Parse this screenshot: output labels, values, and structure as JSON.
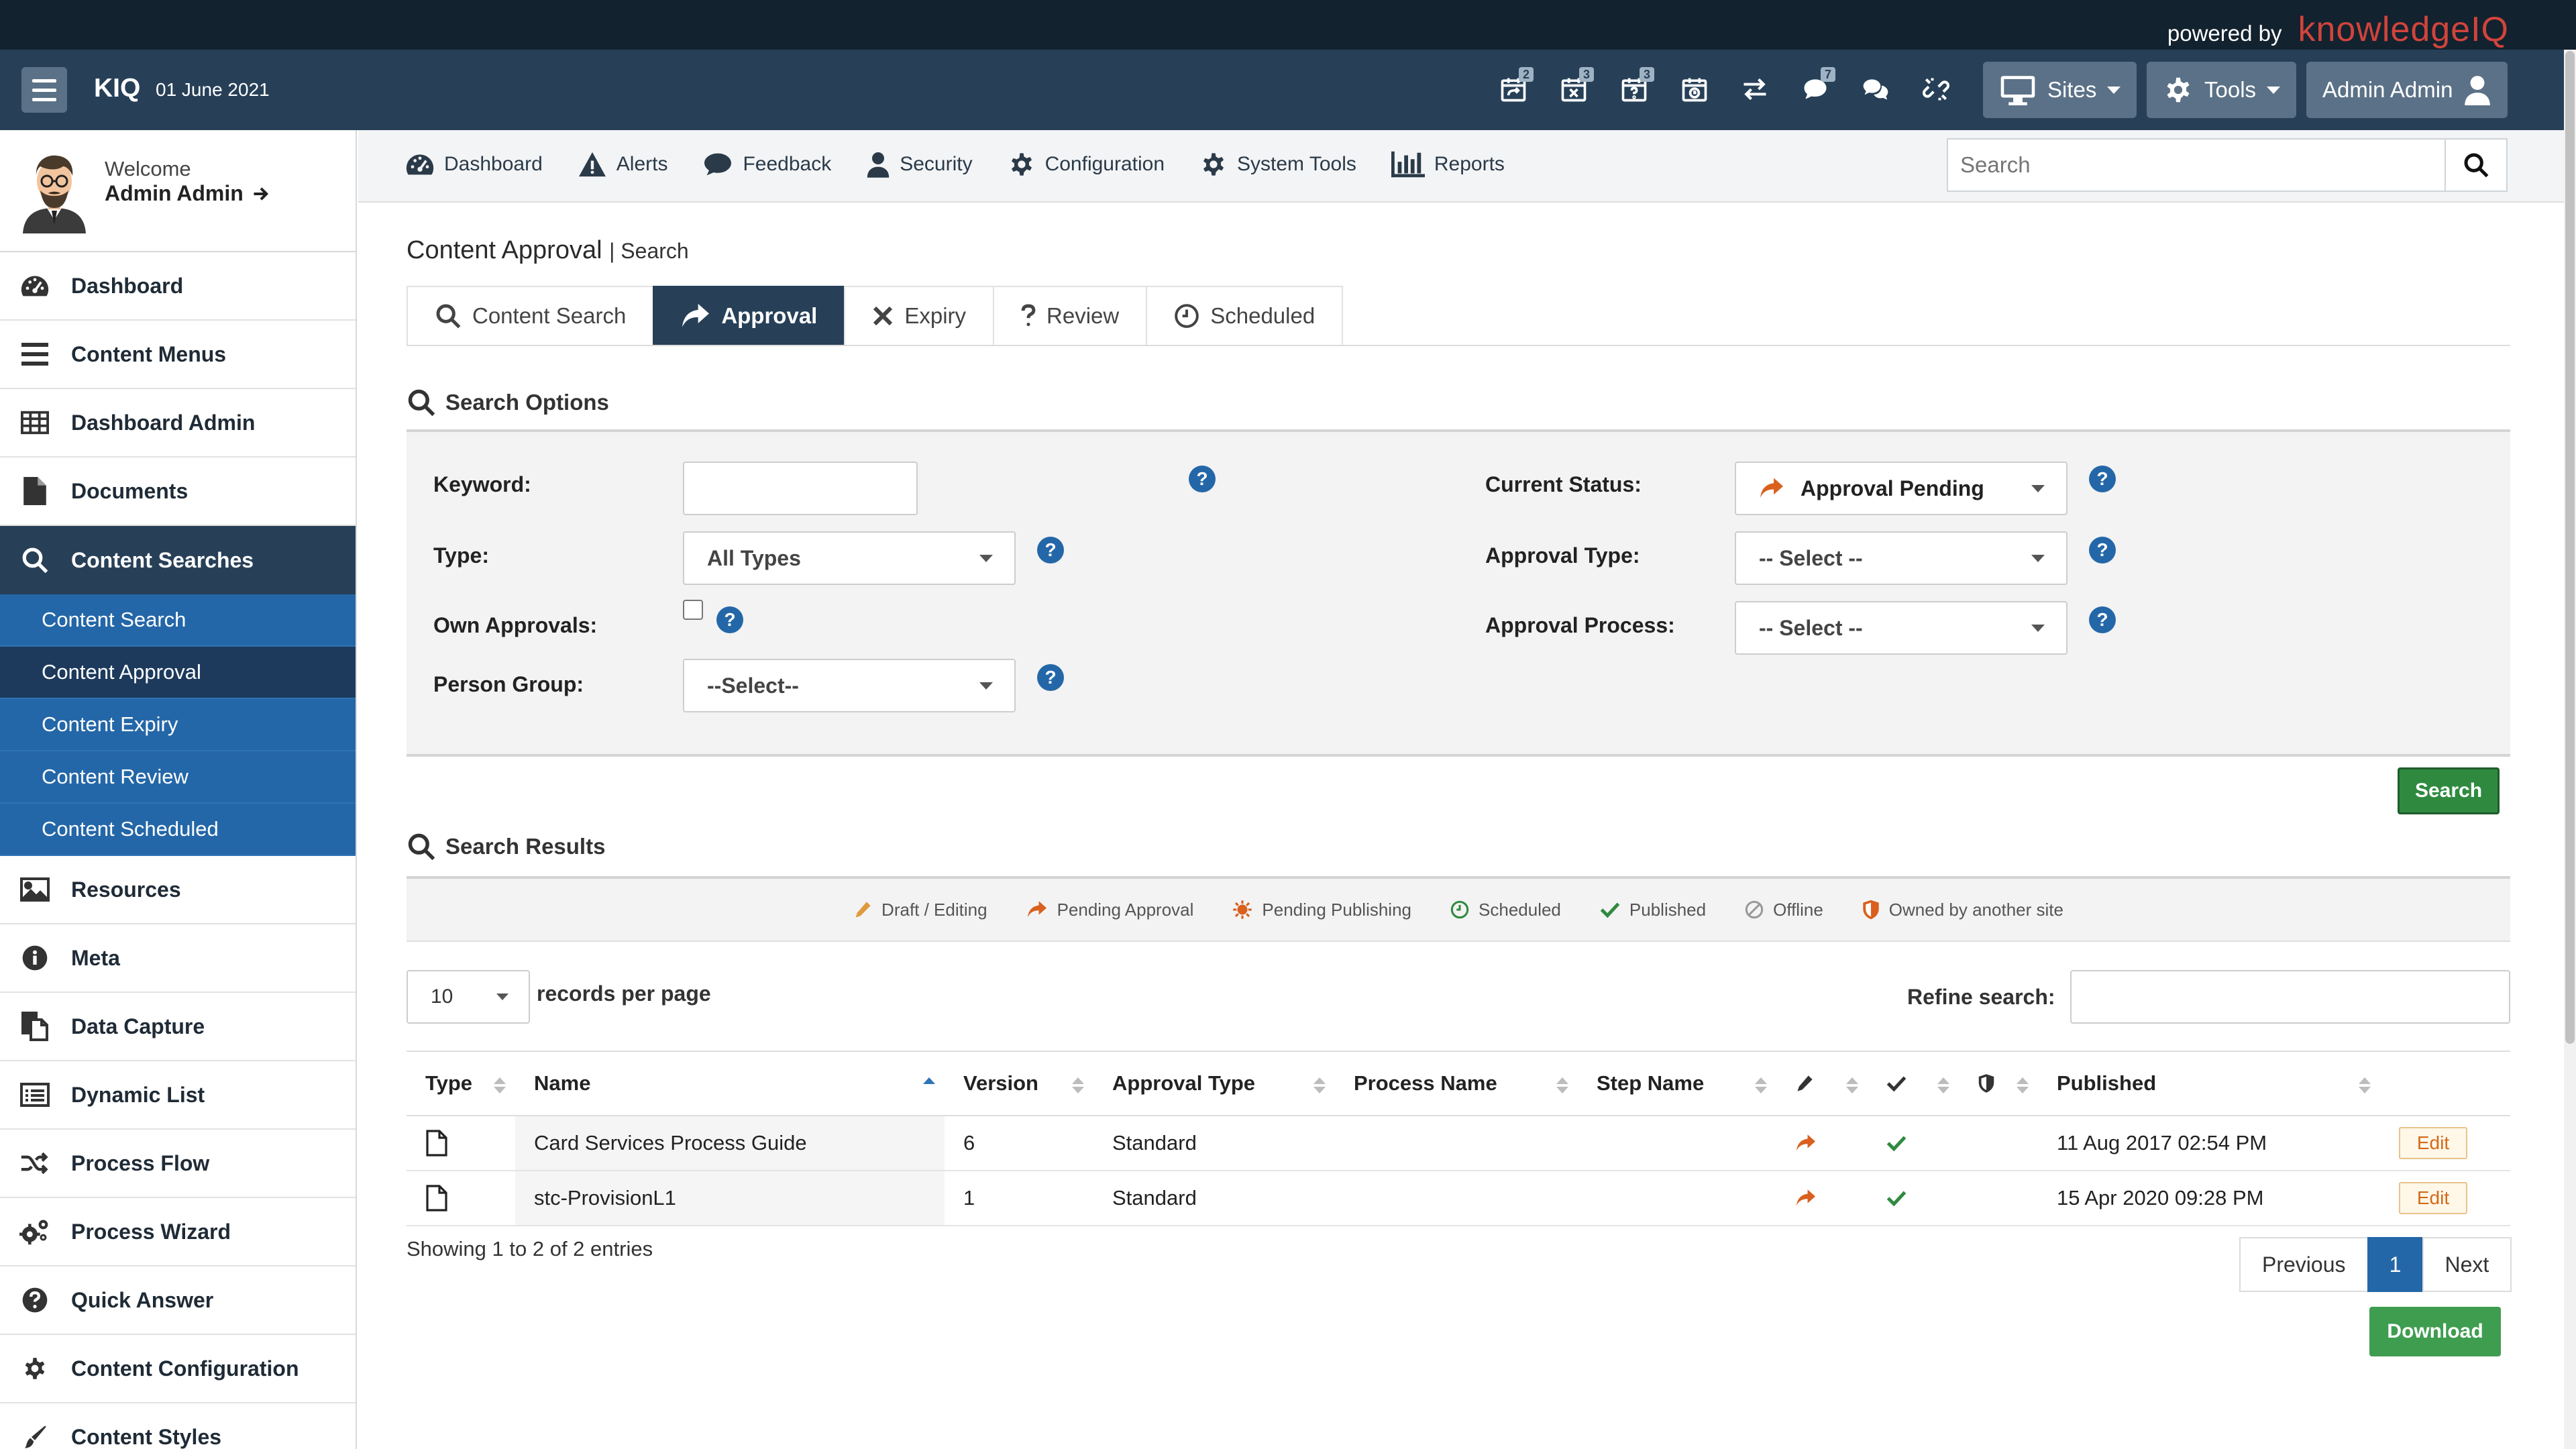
{
  "brand": {
    "powered_by": "powered by",
    "name": "knowledgeIQ",
    "accent": "#d1443c"
  },
  "nav": {
    "logo": "KIQ",
    "date": "01 June 2021",
    "icons": [
      {
        "icon": "calendar-share-icon",
        "badge": "2"
      },
      {
        "icon": "calendar-x-icon",
        "badge": "3"
      },
      {
        "icon": "calendar-question-icon",
        "badge": "3"
      },
      {
        "icon": "calendar-clock-icon",
        "badge": ""
      },
      {
        "icon": "exchange-icon",
        "badge": ""
      },
      {
        "icon": "comment-icon",
        "badge": "7"
      },
      {
        "icon": "comments-icon",
        "badge": ""
      },
      {
        "icon": "unlink-icon",
        "badge": ""
      }
    ],
    "sites_label": "Sites",
    "tools_label": "Tools",
    "user_label": "Admin Admin"
  },
  "sidebar": {
    "welcome": "Welcome",
    "user": "Admin Admin",
    "items_top": [
      {
        "label": "Dashboard",
        "icon": "tachometer-icon"
      },
      {
        "label": "Content Menus",
        "icon": "bars-icon"
      },
      {
        "label": "Dashboard Admin",
        "icon": "table-icon"
      },
      {
        "label": "Documents",
        "icon": "file-icon"
      }
    ],
    "active_item": {
      "label": "Content Searches",
      "icon": "search-icon"
    },
    "sub_items": [
      {
        "label": "Content Search"
      },
      {
        "label": "Content Approval"
      },
      {
        "label": "Content Expiry"
      },
      {
        "label": "Content Review"
      },
      {
        "label": "Content Scheduled"
      }
    ],
    "items_bottom": [
      {
        "label": "Resources",
        "icon": "image-icon"
      },
      {
        "label": "Meta",
        "icon": "info-icon"
      },
      {
        "label": "Data Capture",
        "icon": "copy-icon"
      },
      {
        "label": "Dynamic List",
        "icon": "list-icon"
      },
      {
        "label": "Process Flow",
        "icon": "random-icon"
      },
      {
        "label": "Process Wizard",
        "icon": "cogs-icon"
      },
      {
        "label": "Quick Answer",
        "icon": "question-icon"
      },
      {
        "label": "Content Configuration",
        "icon": "gear-icon"
      },
      {
        "label": "Content Styles",
        "icon": "brush-icon"
      }
    ]
  },
  "toolbar": {
    "items": [
      {
        "label": "Dashboard",
        "icon": "tachometer-icon"
      },
      {
        "label": "Alerts",
        "icon": "warning-icon"
      },
      {
        "label": "Feedback",
        "icon": "comment-icon"
      },
      {
        "label": "Security",
        "icon": "user-icon"
      },
      {
        "label": "Configuration",
        "icon": "gear-icon"
      },
      {
        "label": "System Tools",
        "icon": "gear-icon"
      },
      {
        "label": "Reports",
        "icon": "bar-chart-icon"
      }
    ],
    "search_placeholder": "Search"
  },
  "page": {
    "title": "Content Approval",
    "subtitle": "| Search"
  },
  "tabs": [
    {
      "label": "Content Search",
      "icon": "search-icon"
    },
    {
      "label": "Approval",
      "icon": "share-icon"
    },
    {
      "label": "Expiry",
      "icon": "times-icon"
    },
    {
      "label": "Review",
      "icon": "question-mark-icon"
    },
    {
      "label": "Scheduled",
      "icon": "clock-icon"
    }
  ],
  "search_options": {
    "heading": "Search Options",
    "keyword_label": "Keyword:",
    "keyword_value": "",
    "type_label": "Type:",
    "type_value": "All Types",
    "own_approvals_label": "Own Approvals:",
    "person_group_label": "Person Group:",
    "person_group_value": "--Select--",
    "current_status_label": "Current Status:",
    "current_status_value": "Approval Pending",
    "approval_type_label": "Approval Type:",
    "approval_type_value": "-- Select --",
    "approval_process_label": "Approval Process:",
    "approval_process_value": "-- Select --",
    "search_button": "Search"
  },
  "results": {
    "heading": "Search Results",
    "legend": [
      {
        "label": "Draft / Editing",
        "icon": "pencil-icon",
        "color": "#e09a3e"
      },
      {
        "label": "Pending Approval",
        "icon": "share-icon",
        "color": "#d9601e"
      },
      {
        "label": "Pending Publishing",
        "icon": "sun-icon",
        "color": "#d9601e"
      },
      {
        "label": "Scheduled",
        "icon": "clock-icon",
        "color": "#2f8a40"
      },
      {
        "label": "Published",
        "icon": "check-icon",
        "color": "#2f8a40"
      },
      {
        "label": "Offline",
        "icon": "ban-icon",
        "color": "#999999"
      },
      {
        "label": "Owned by another site",
        "icon": "shield-icon",
        "color": "#d9601e"
      }
    ],
    "per_page_value": "10",
    "per_page_label": "records per page",
    "refine_label": "Refine search:",
    "refine_value": "",
    "columns": [
      "Type",
      "Name",
      "Version",
      "Approval Type",
      "Process Name",
      "Step Name",
      "",
      "",
      "",
      "Published",
      ""
    ],
    "rows": [
      {
        "name": "Card Services Process Guide",
        "version": "6",
        "approval_type": "Standard",
        "process_name": "",
        "step_name": "",
        "published": "11 Aug 2017 02:54 PM",
        "edit": "Edit"
      },
      {
        "name": "stc-ProvisionL1",
        "version": "1",
        "approval_type": "Standard",
        "process_name": "",
        "step_name": "",
        "published": "15 Apr 2020 09:28 PM",
        "edit": "Edit"
      }
    ],
    "showing": "Showing 1 to 2 of 2 entries",
    "prev_label": "Previous",
    "current_page": "1",
    "next_label": "Next",
    "download_label": "Download"
  },
  "colors": {
    "nav": "#274058",
    "brandbar": "#12222e",
    "primary": "#2467a8",
    "success": "#2f8a40",
    "pending": "#d9601e"
  }
}
